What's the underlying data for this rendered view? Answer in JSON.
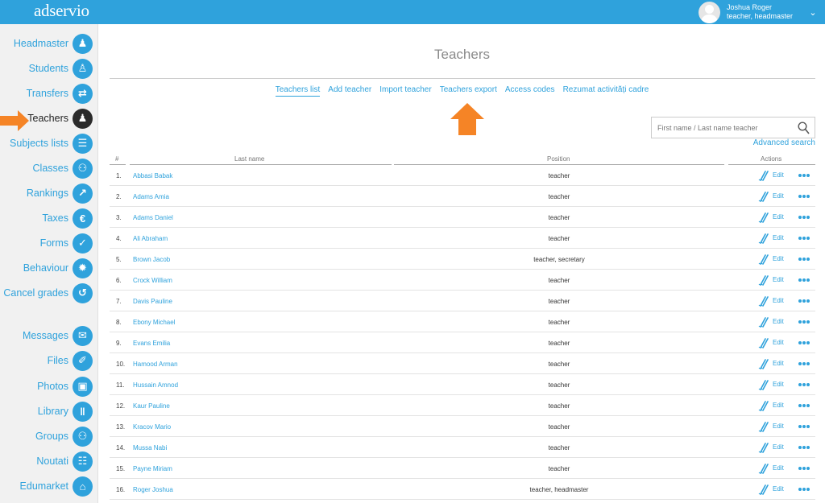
{
  "app": {
    "logo": "adservio"
  },
  "user": {
    "name": "Joshua Roger",
    "role": "teacher, headmaster"
  },
  "sidebar": {
    "items": [
      {
        "label": "Headmaster",
        "icon": "person-tie-icon",
        "glyph": "♟"
      },
      {
        "label": "Students",
        "icon": "graduate-icon",
        "glyph": "♙"
      },
      {
        "label": "Transfers",
        "icon": "transfer-arrows-icon",
        "glyph": "⇄"
      },
      {
        "label": "Teachers",
        "icon": "teacher-icon",
        "glyph": "♟",
        "active": true
      },
      {
        "label": "Subjects lists",
        "icon": "list-icon",
        "glyph": "☰"
      },
      {
        "label": "Classes",
        "icon": "group-icon",
        "glyph": "⚇"
      },
      {
        "label": "Rankings",
        "icon": "trend-icon",
        "glyph": "↗"
      },
      {
        "label": "Taxes",
        "icon": "euro-icon",
        "glyph": "€"
      },
      {
        "label": "Forms",
        "icon": "form-check-icon",
        "glyph": "✓"
      },
      {
        "label": "Behaviour",
        "icon": "medal-icon",
        "glyph": "✹"
      },
      {
        "label": "Cancel grades",
        "icon": "cancel-grade-icon",
        "glyph": "↺"
      },
      {
        "label": "Messages",
        "icon": "envelope-icon",
        "glyph": "✉"
      },
      {
        "label": "Files",
        "icon": "paperclip-icon",
        "glyph": "✐"
      },
      {
        "label": "Photos",
        "icon": "photo-icon",
        "glyph": "▣"
      },
      {
        "label": "Library",
        "icon": "books-icon",
        "glyph": "‖"
      },
      {
        "label": "Groups",
        "icon": "people-icon",
        "glyph": "⚇"
      },
      {
        "label": "Noutati",
        "icon": "news-icon",
        "glyph": "☷"
      },
      {
        "label": "Edumarket",
        "icon": "cart-icon",
        "glyph": "⌂"
      }
    ]
  },
  "main": {
    "title": "Teachers",
    "tabs": [
      {
        "label": "Teachers list",
        "active": true
      },
      {
        "label": "Add teacher"
      },
      {
        "label": "Import teacher"
      },
      {
        "label": "Teachers export"
      },
      {
        "label": "Access codes"
      },
      {
        "label": "Rezumat activități cadre"
      }
    ],
    "search": {
      "placeholder": "First name / Last name teacher",
      "advanced_label": "Advanced search"
    },
    "table": {
      "headers": {
        "index": "#",
        "name": "Last name",
        "position": "Position",
        "actions": "Actions"
      },
      "edit_label": "Edit",
      "rows": [
        {
          "index": "1.",
          "name": "Abbasi Babak",
          "position": "teacher"
        },
        {
          "index": "2.",
          "name": "Adams Amia",
          "position": "teacher"
        },
        {
          "index": "3.",
          "name": "Adams Daniel",
          "position": "teacher"
        },
        {
          "index": "4.",
          "name": "Ali Abraham",
          "position": "teacher"
        },
        {
          "index": "5.",
          "name": "Brown Jacob",
          "position": "teacher, secretary"
        },
        {
          "index": "6.",
          "name": "Crock William",
          "position": "teacher"
        },
        {
          "index": "7.",
          "name": "Davis Pauline",
          "position": "teacher"
        },
        {
          "index": "8.",
          "name": "Ebony Michael",
          "position": "teacher"
        },
        {
          "index": "9.",
          "name": "Evans Emilia",
          "position": "teacher"
        },
        {
          "index": "10.",
          "name": "Hamood Arman",
          "position": "teacher"
        },
        {
          "index": "11.",
          "name": "Hussain Amnod",
          "position": "teacher"
        },
        {
          "index": "12.",
          "name": "Kaur Pauline",
          "position": "teacher"
        },
        {
          "index": "13.",
          "name": "Kracov Mario",
          "position": "teacher"
        },
        {
          "index": "14.",
          "name": "Mussa Nabi",
          "position": "teacher"
        },
        {
          "index": "15.",
          "name": "Payne Miriam",
          "position": "teacher"
        },
        {
          "index": "16.",
          "name": "Roger Joshua",
          "position": "teacher, headmaster"
        }
      ]
    }
  },
  "colors": {
    "brand": "#2fa2dc",
    "active_icon": "#2b2b2b",
    "highlight_arrow": "#f58426"
  }
}
